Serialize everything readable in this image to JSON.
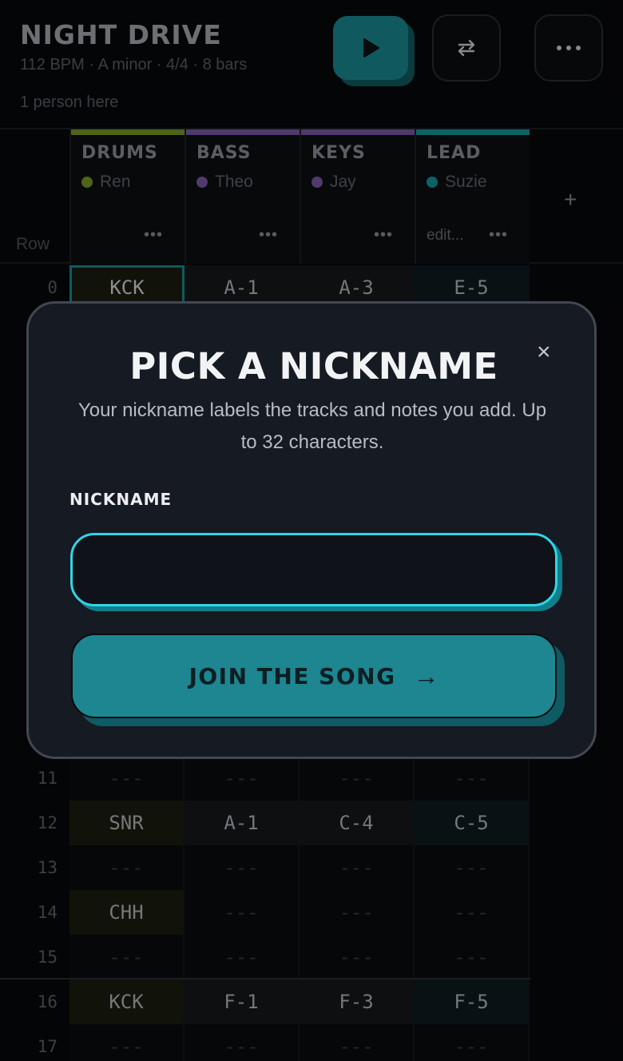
{
  "song": {
    "title": "NIGHT DRIVE",
    "meta": "112 BPM · A minor · 4/4 · 8 bars",
    "presence": "1 person here"
  },
  "toolbar": {
    "play_icon": "play-icon",
    "loop_icon": "repeat-icon",
    "more_icon": "more-horizontal-icon"
  },
  "grid": {
    "row_header": "Row",
    "add_track": "+",
    "tracks": [
      {
        "name": "DRUMS",
        "owner": "Ren",
        "color": "#7a9a25",
        "more": "•••",
        "status": ""
      },
      {
        "name": "BASS",
        "owner": "Theo",
        "color": "#7b5aa6",
        "more": "•••",
        "status": ""
      },
      {
        "name": "KEYS",
        "owner": "Jay",
        "color": "#7b5aa6",
        "more": "•••",
        "status": ""
      },
      {
        "name": "LEAD",
        "owner": "Suzie",
        "color": "#14979c",
        "more": "•••",
        "status": "edit..."
      }
    ],
    "rows": [
      {
        "num": "0",
        "cells": [
          "KCK",
          "A-1",
          "A-3",
          "E-5"
        ]
      },
      {
        "num": "11",
        "cells": [
          "---",
          "---",
          "---",
          "---"
        ]
      },
      {
        "num": "12",
        "cells": [
          "SNR",
          "A-1",
          "C-4",
          "C-5"
        ]
      },
      {
        "num": "13",
        "cells": [
          "---",
          "---",
          "---",
          "---"
        ]
      },
      {
        "num": "14",
        "cells": [
          "CHH",
          "---",
          "---",
          "---"
        ]
      },
      {
        "num": "15",
        "cells": [
          "---",
          "---",
          "---",
          "---"
        ]
      },
      {
        "num": "16",
        "cells": [
          "KCK",
          "F-1",
          "F-3",
          "F-5"
        ]
      },
      {
        "num": "17",
        "cells": [
          "---",
          "---",
          "---",
          "---"
        ]
      }
    ]
  },
  "modal": {
    "title": "PICK A NICKNAME",
    "close": "×",
    "description": "Your nickname labels the tracks and notes you add. Up to 32 characters.",
    "field_label": "NICKNAME",
    "input_value": "",
    "input_placeholder": "",
    "submit_label": "JOIN THE SONG",
    "submit_arrow": "→"
  }
}
